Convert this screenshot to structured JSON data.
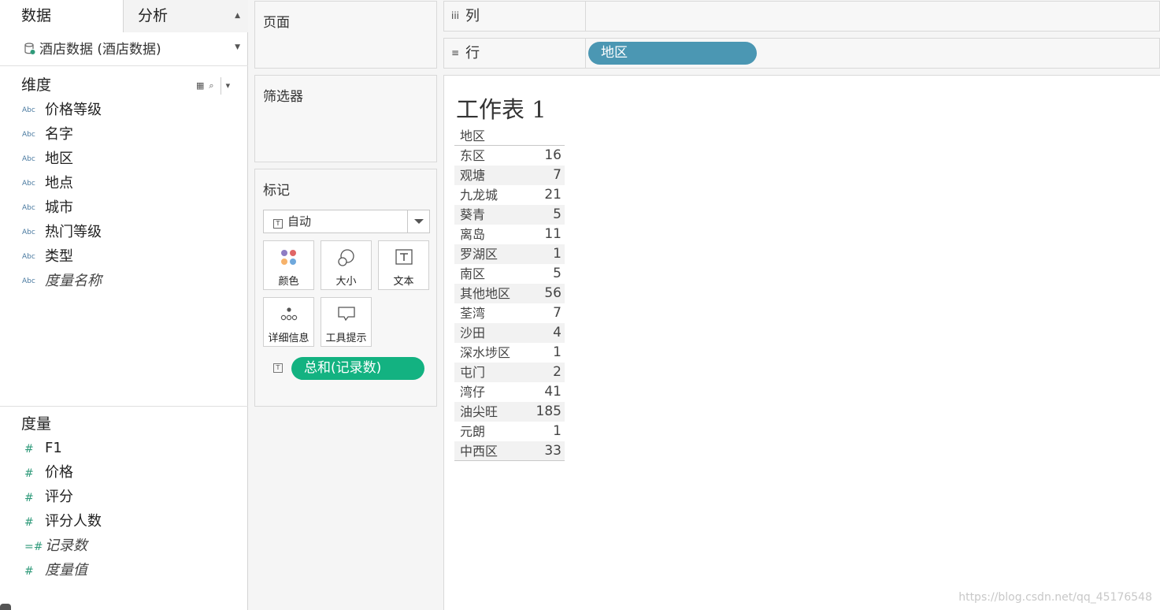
{
  "left_pane": {
    "tabs": {
      "data": "数据",
      "analysis": "分析"
    },
    "datasource": "酒店数据 (酒店数据)",
    "dimensions_title": "维度",
    "dimensions": [
      {
        "label": "价格等级",
        "type": "Abc",
        "italic": false
      },
      {
        "label": "名字",
        "type": "Abc",
        "italic": false
      },
      {
        "label": "地区",
        "type": "Abc",
        "italic": false
      },
      {
        "label": "地点",
        "type": "Abc",
        "italic": false
      },
      {
        "label": "城市",
        "type": "Abc",
        "italic": false
      },
      {
        "label": "热门等级",
        "type": "Abc",
        "italic": false
      },
      {
        "label": "类型",
        "type": "Abc",
        "italic": false
      },
      {
        "label": "度量名称",
        "type": "Abc",
        "italic": true
      }
    ],
    "measures_title": "度量",
    "measures": [
      {
        "label": "F1",
        "type": "#",
        "italic": false
      },
      {
        "label": "价格",
        "type": "#",
        "italic": false
      },
      {
        "label": "评分",
        "type": "#",
        "italic": false
      },
      {
        "label": "评分人数",
        "type": "#",
        "italic": false
      },
      {
        "label": "记录数",
        "type": "=#",
        "italic": true
      },
      {
        "label": "度量值",
        "type": "#",
        "italic": true
      }
    ]
  },
  "cards": {
    "pages": "页面",
    "filters": "筛选器",
    "marks": {
      "title": "标记",
      "mark_type": "自动",
      "mark_type_icon": "T",
      "buttons": {
        "color": "颜色",
        "size": "大小",
        "text": "文本",
        "detail": "详细信息",
        "tooltip": "工具提示"
      },
      "field_pill": "总和(记录数)"
    }
  },
  "shelves": {
    "columns_label": "列",
    "columns_icon": "iii",
    "rows_label": "行",
    "rows_icon": "≡",
    "rows_pill": "地区"
  },
  "viz": {
    "sheet_title": "工作表 1",
    "table_header": "地区",
    "rows": [
      {
        "name": "东区",
        "value": "16"
      },
      {
        "name": "观塘",
        "value": "7"
      },
      {
        "name": "九龙城",
        "value": "21"
      },
      {
        "name": "葵青",
        "value": "5"
      },
      {
        "name": "离岛",
        "value": "11"
      },
      {
        "name": "罗湖区",
        "value": "1"
      },
      {
        "name": "南区",
        "value": "5"
      },
      {
        "name": "其他地区",
        "value": "56"
      },
      {
        "name": "荃湾",
        "value": "7"
      },
      {
        "name": "沙田",
        "value": "4"
      },
      {
        "name": "深水埗区",
        "value": "1"
      },
      {
        "name": "屯门",
        "value": "2"
      },
      {
        "name": "湾仔",
        "value": "41"
      },
      {
        "name": "油尖旺",
        "value": "185"
      },
      {
        "name": "元朗",
        "value": "1"
      },
      {
        "name": "中西区",
        "value": "33"
      }
    ],
    "watermark": "https://blog.csdn.net/qq_45176548"
  }
}
